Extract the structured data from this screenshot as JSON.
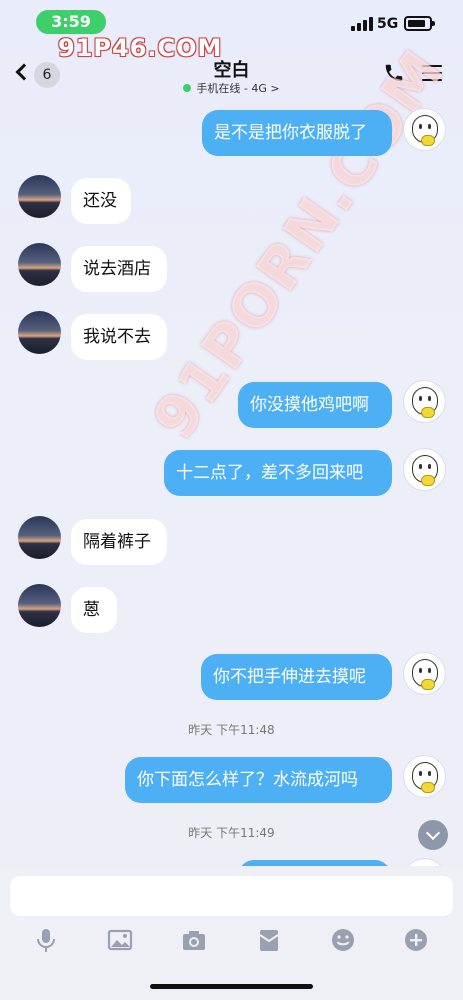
{
  "status_bar": {
    "time": "3:59",
    "network": "5G"
  },
  "nav": {
    "unread_count": "6",
    "contact_name": "空白",
    "online_status": "手机在线 - 4G >"
  },
  "watermark": {
    "top": "91P46.COM",
    "diagonal": "91PORN.COM"
  },
  "messages": [
    {
      "dir": "out",
      "text": "是不是把你衣服脱了"
    },
    {
      "dir": "in",
      "text": "还没"
    },
    {
      "dir": "in",
      "text": "说去酒店"
    },
    {
      "dir": "in",
      "text": "我说不去"
    },
    {
      "dir": "out",
      "text": "你没摸他鸡吧啊"
    },
    {
      "dir": "out",
      "text": "十二点了，差不多回来吧"
    },
    {
      "dir": "in",
      "text": "隔着裤子"
    },
    {
      "dir": "in",
      "text": "蒽"
    },
    {
      "dir": "out",
      "text": "你不把手伸进去摸呢"
    },
    {
      "dir": "out",
      "text": "你下面怎么样了？水流成河吗"
    }
  ],
  "timestamps": [
    "昨天 下午11:48",
    "昨天 下午11:49"
  ],
  "input": {
    "placeholder": ""
  },
  "toolbar": {
    "icons": [
      "microphone-icon",
      "image-icon",
      "camera-icon",
      "red-packet-icon",
      "emoji-icon",
      "plus-icon"
    ]
  },
  "colors": {
    "outgoing_bubble": "#4db0f5",
    "incoming_bubble": "#ffffff",
    "online_dot": "#3fcf6a",
    "time_pill": "#3fcf6a"
  }
}
